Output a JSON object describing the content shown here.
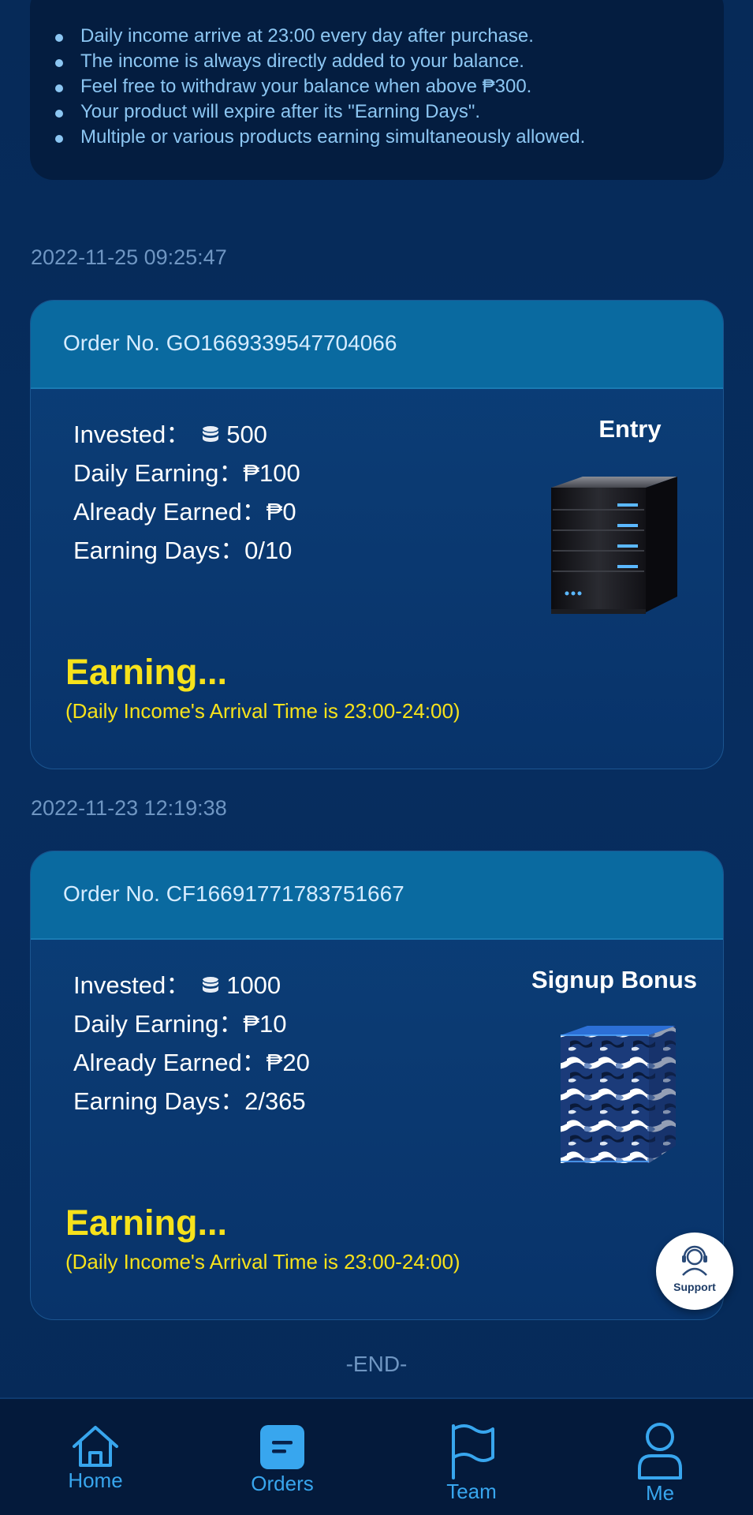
{
  "rules": {
    "items": [
      "Daily income arrive at 23:00 every day after purchase.",
      "The income is always directly added to your balance.",
      "Feel free to withdraw your balance when above ₱300.",
      "Your product will expire after its \"Earning Days\".",
      "Multiple or various products earning simultaneously allowed."
    ]
  },
  "orders": [
    {
      "timestamp": "2022-11-25 09:25:47",
      "order_no": "Order No. GO1669339547704066",
      "invested_label": "Invested：",
      "invested_value": "500",
      "daily_earning": "Daily Earning：₱100",
      "already_earned": "Already Earned：₱0",
      "earning_days": "Earning Days：0/10",
      "product_name": "Entry",
      "status": "Earning...",
      "status_note": "(Daily Income's Arrival Time is 23:00-24:00)"
    },
    {
      "timestamp": "2022-11-23 12:19:38",
      "order_no": "Order No. CF1669177178375166​7",
      "invested_label": "Invested：",
      "invested_value": "1000",
      "daily_earning": "Daily Earning：₱10",
      "already_earned": "Already Earned：₱20",
      "earning_days": "Earning Days：2/365",
      "product_name": "Signup Bonus",
      "status": "Earning...",
      "status_note": "(Daily Income's Arrival Time is 23:00-24:00)"
    }
  ],
  "end_text": "-END-",
  "support_label": "Support",
  "nav": {
    "home": "Home",
    "orders": "Orders",
    "team": "Team",
    "me": "Me"
  },
  "colors": {
    "background": "#062a58",
    "card_header": "#0a6aa0",
    "accent_yellow": "#f7e21b",
    "nav_blue": "#38a6ee"
  }
}
